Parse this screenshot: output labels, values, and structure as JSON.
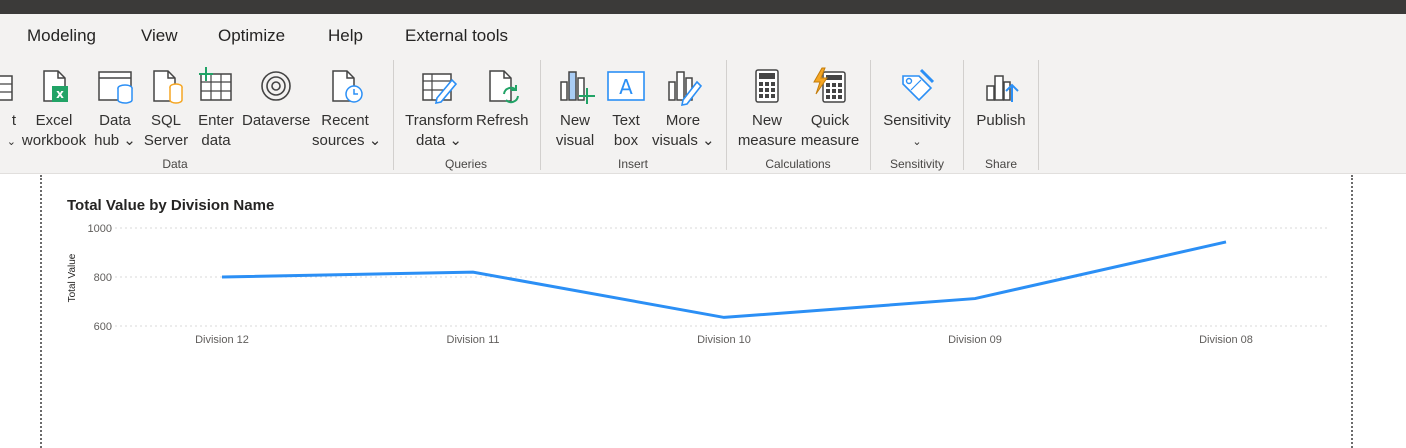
{
  "menu": {
    "items": [
      "Modeling",
      "View",
      "Optimize",
      "Help",
      "External tools"
    ]
  },
  "ribbon": {
    "partial_left": {
      "line1": "t",
      "line2": "⌄"
    },
    "data_group": {
      "label": "Data",
      "buttons": [
        {
          "l1": "Excel",
          "l2": "workbook",
          "icon": "excel-icon"
        },
        {
          "l1": "Data",
          "l2": "hub ⌄",
          "icon": "data-hub-icon"
        },
        {
          "l1": "SQL",
          "l2": "Server",
          "icon": "sql-server-icon"
        },
        {
          "l1": "Enter",
          "l2": "data",
          "icon": "enter-data-icon"
        },
        {
          "l1": "Dataverse",
          "l2": "",
          "icon": "dataverse-icon"
        },
        {
          "l1": "Recent",
          "l2": "sources ⌄",
          "icon": "recent-sources-icon"
        }
      ]
    },
    "queries_group": {
      "label": "Queries",
      "buttons": [
        {
          "l1": "Transform",
          "l2": "data ⌄",
          "icon": "transform-data-icon"
        },
        {
          "l1": "Refresh",
          "l2": "",
          "icon": "refresh-icon"
        }
      ]
    },
    "insert_group": {
      "label": "Insert",
      "buttons": [
        {
          "l1": "New",
          "l2": "visual",
          "icon": "new-visual-icon"
        },
        {
          "l1": "Text",
          "l2": "box",
          "icon": "text-box-icon"
        },
        {
          "l1": "More",
          "l2": "visuals ⌄",
          "icon": "more-visuals-icon"
        }
      ]
    },
    "calculations_group": {
      "label": "Calculations",
      "buttons": [
        {
          "l1": "New",
          "l2": "measure",
          "icon": "new-measure-icon"
        },
        {
          "l1": "Quick",
          "l2": "measure",
          "icon": "quick-measure-icon"
        }
      ]
    },
    "sensitivity_group": {
      "label": "Sensitivity",
      "buttons": [
        {
          "l1": "Sensitivity",
          "l2": "⌄",
          "icon": "sensitivity-icon"
        }
      ]
    },
    "share_group": {
      "label": "Share",
      "buttons": [
        {
          "l1": "Publish",
          "l2": "",
          "icon": "publish-icon"
        }
      ]
    }
  },
  "colors": {
    "line": "#2b8ff5",
    "accent_green": "#21a366",
    "accent_orange": "#f5a623"
  },
  "chart_data": {
    "type": "line",
    "title": "Total Value by Division Name",
    "xlabel": "",
    "ylabel": "Total Value",
    "categories": [
      "Division 12",
      "Division 11",
      "Division 10",
      "Division 09",
      "Division 08"
    ],
    "values": [
      800,
      820,
      635,
      712,
      943
    ],
    "ylim": [
      600,
      1000
    ],
    "yticks": [
      "1000",
      "800",
      "600"
    ],
    "grid": true
  }
}
